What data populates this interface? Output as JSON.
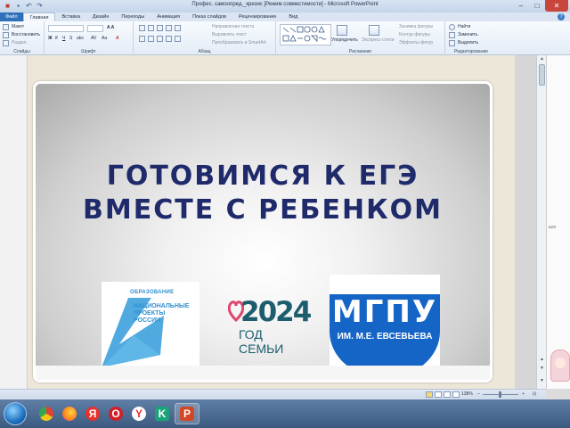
{
  "window": {
    "title": "Профес. самоопред._кризис [Режим совместимости] - Microsoft PowerPoint"
  },
  "tabs": [
    "Файл",
    "Главная",
    "Вставка",
    "Дизайн",
    "Переходы",
    "Анимация",
    "Показ слайдов",
    "Рецензирование",
    "Вид"
  ],
  "active_tab": "Главная",
  "ribbon": {
    "clipboard": {
      "layout": "Макет",
      "reset": "Восстановить",
      "section": "Раздел",
      "label": "Слайды"
    },
    "font": {
      "label": "Шрифт"
    },
    "paragraph": {
      "text_direction": "Направление текста",
      "align_text": "Выровнять текст",
      "smartart": "Преобразовать в SmartArt",
      "label": "Абзац"
    },
    "drawing": {
      "arrange": "Упорядочить",
      "quick_styles": "Экспресс-стили",
      "fill": "Заливка фигуры",
      "outline": "Контур фигуры",
      "effects": "Эффекты фигур",
      "label": "Рисование"
    },
    "editing": {
      "find": "Найти",
      "replace": "Заменить",
      "select": "Выделить",
      "label": "Редактирование"
    }
  },
  "slide": {
    "headline_line1": "ГОТОВИМСЯ К ЕГЭ",
    "headline_line2": "ВМЕСТЕ С РЕБЕНКОМ",
    "logo_education": {
      "top": "ОБРАЗОВАНИЕ",
      "line1": "НАЦИОНАЛЬНЫЕ",
      "line2": "ПРОЕКТЫ",
      "line3": "РОССИИ"
    },
    "logo_year": {
      "year": "2024",
      "caption": "ГОД СЕМЬИ"
    },
    "logo_mgpu": {
      "abbr": "МГПУ",
      "name": "ИМ. М.Е. ЕВСЕВЬЕВА"
    }
  },
  "status": {
    "zoom": "138%"
  },
  "outside_fragment": {
    "text": "ься"
  },
  "taskbar": {
    "items": [
      {
        "name": "explorer",
        "color": "#e8c25a"
      },
      {
        "name": "chrome",
        "color": "#e34133"
      },
      {
        "name": "firefox",
        "color": "#ff8a1f"
      },
      {
        "name": "yandex",
        "color": "#e5322d",
        "glyph": "Я"
      },
      {
        "name": "opera",
        "color": "#d11f2a",
        "glyph": "O"
      },
      {
        "name": "yandex-browser",
        "color": "#f5c518",
        "glyph": "Y"
      },
      {
        "name": "kaspersky",
        "color": "#1aa37a",
        "glyph": "K"
      },
      {
        "name": "powerpoint",
        "color": "#d24726",
        "glyph": "P"
      }
    ]
  }
}
